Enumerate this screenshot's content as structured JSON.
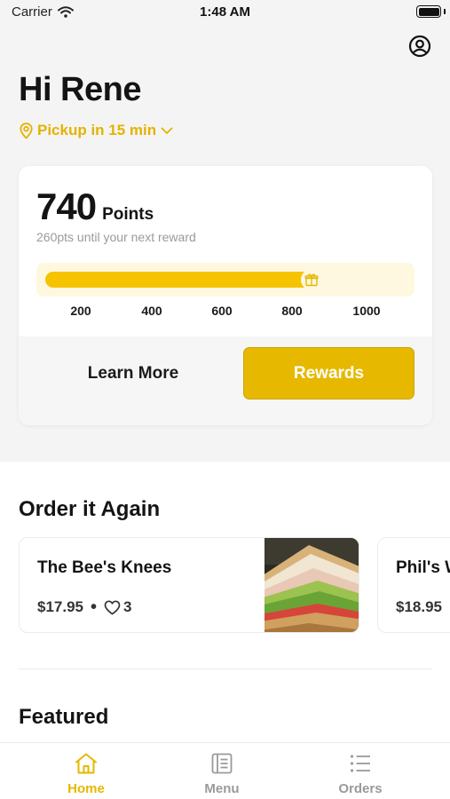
{
  "status_bar": {
    "carrier": "Carrier",
    "time": "1:48 AM"
  },
  "header": {
    "greeting": "Hi Rene",
    "pickup_label": "Pickup in 15 min"
  },
  "rewards": {
    "points_value": "740",
    "points_unit": "Points",
    "subtitle": "260pts until your next reward",
    "progress_fraction": 0.74,
    "ticks": [
      "200",
      "400",
      "600",
      "800",
      "1000"
    ],
    "learn_more_label": "Learn More",
    "rewards_label": "Rewards"
  },
  "order_again": {
    "title": "Order it Again",
    "items": [
      {
        "name": "The Bee's Knees",
        "price": "$17.95",
        "likes": "3"
      },
      {
        "name": "Phil's W",
        "price": "$18.95"
      }
    ]
  },
  "featured": {
    "title": "Featured"
  },
  "bottom_nav": {
    "items": [
      {
        "label": "Home",
        "icon": "home-icon",
        "active": true
      },
      {
        "label": "Menu",
        "icon": "menu-book-icon",
        "active": false
      },
      {
        "label": "Orders",
        "icon": "list-icon",
        "active": false
      }
    ]
  },
  "colors": {
    "accent": "#e6b800",
    "progress": "#f5c300",
    "progress_track": "#fff8e1",
    "inactive": "#9a9a9a"
  }
}
